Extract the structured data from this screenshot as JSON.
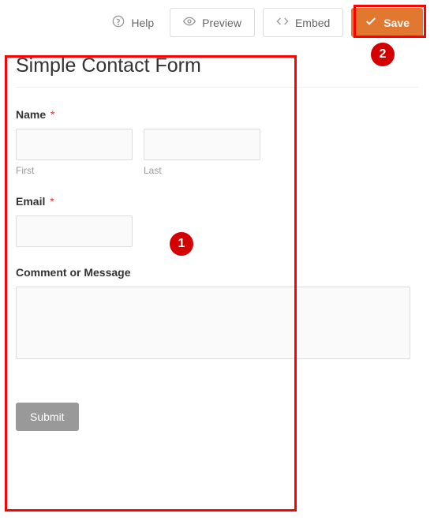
{
  "toolbar": {
    "help": "Help",
    "preview": "Preview",
    "embed": "Embed",
    "save": "Save"
  },
  "form": {
    "title": "Simple Contact Form",
    "name_label": "Name",
    "first_sub": "First",
    "last_sub": "Last",
    "email_label": "Email",
    "comment_label": "Comment or Message",
    "submit": "Submit",
    "required_mark": "*"
  },
  "callouts": {
    "one": "1",
    "two": "2"
  }
}
